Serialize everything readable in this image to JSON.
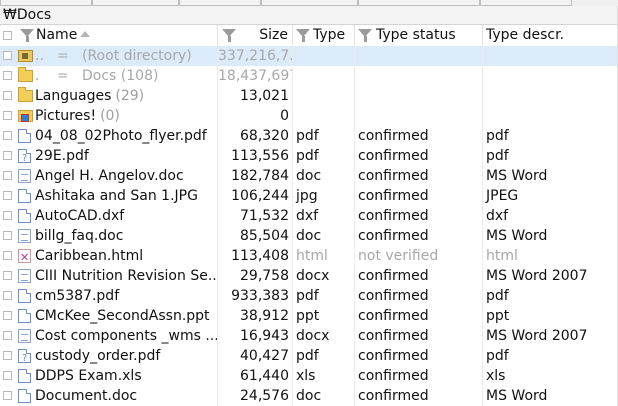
{
  "path": "₩Docs",
  "columns": {
    "name": "Name",
    "size": "Size",
    "type": "Type",
    "type_status": "Type status",
    "type_descr": "Type descr."
  },
  "pseudo_rows": [
    {
      "dots": "..",
      "eq": "=",
      "label": "(Root directory)",
      "size": "337,216,7..."
    },
    {
      "dots": ".",
      "eq": "=",
      "label": "Docs (108)",
      "size": "18,437,697"
    }
  ],
  "folders": [
    {
      "name": "Languages",
      "count": "(29)",
      "size": "13,021"
    },
    {
      "name": "Pictures!",
      "count": "(0)",
      "size": "0"
    }
  ],
  "files": [
    {
      "icon": "file-icon",
      "name": "04_08_02Photo_flyer.pdf",
      "size": "68,320",
      "type": "pdf",
      "status": "confirmed",
      "descr": "pdf"
    },
    {
      "icon": "pdf-unknown-icon",
      "name": "29E.pdf",
      "size": "113,556",
      "type": "pdf",
      "status": "confirmed",
      "descr": "pdf"
    },
    {
      "icon": "doc-icon",
      "name": "Angel H. Angelov.doc",
      "size": "182,784",
      "type": "doc",
      "status": "confirmed",
      "descr": "MS Word"
    },
    {
      "icon": "file-icon",
      "name": "Ashitaka and San 1.JPG",
      "size": "106,244",
      "type": "jpg",
      "status": "confirmed",
      "descr": "JPEG"
    },
    {
      "icon": "file-icon",
      "name": "AutoCAD.dxf",
      "size": "71,532",
      "type": "dxf",
      "status": "confirmed",
      "descr": "dxf"
    },
    {
      "icon": "doc-icon",
      "name": "billg_faq.doc",
      "size": "85,504",
      "type": "doc",
      "status": "confirmed",
      "descr": "MS Word"
    },
    {
      "icon": "html-icon",
      "name": "Caribbean.html",
      "size": "113,408",
      "type": "html",
      "status": "not verified",
      "descr": "html",
      "muted": true
    },
    {
      "icon": "doc-icon",
      "name": "CIII Nutrition Revision Se...",
      "size": "29,758",
      "type": "docx",
      "status": "confirmed",
      "descr": "MS Word 2007"
    },
    {
      "icon": "file-icon",
      "name": "cm5387.pdf",
      "size": "933,383",
      "type": "pdf",
      "status": "confirmed",
      "descr": "pdf"
    },
    {
      "icon": "file-icon",
      "name": "CMcKee_SecondAssn.ppt",
      "size": "38,912",
      "type": "ppt",
      "status": "confirmed",
      "descr": "ppt"
    },
    {
      "icon": "doc-icon",
      "name": "Cost components _wms ...",
      "size": "16,943",
      "type": "docx",
      "status": "confirmed",
      "descr": "MS Word 2007"
    },
    {
      "icon": "pdf-unknown-icon",
      "name": "custody_order.pdf",
      "size": "40,427",
      "type": "pdf",
      "status": "confirmed",
      "descr": "pdf"
    },
    {
      "icon": "file-icon",
      "name": "DDPS Exam.xls",
      "size": "61,440",
      "type": "xls",
      "status": "confirmed",
      "descr": "xls"
    },
    {
      "icon": "file-icon",
      "name": "Document.doc",
      "size": "24,576",
      "type": "doc",
      "status": "confirmed",
      "descr": "MS Word"
    }
  ]
}
